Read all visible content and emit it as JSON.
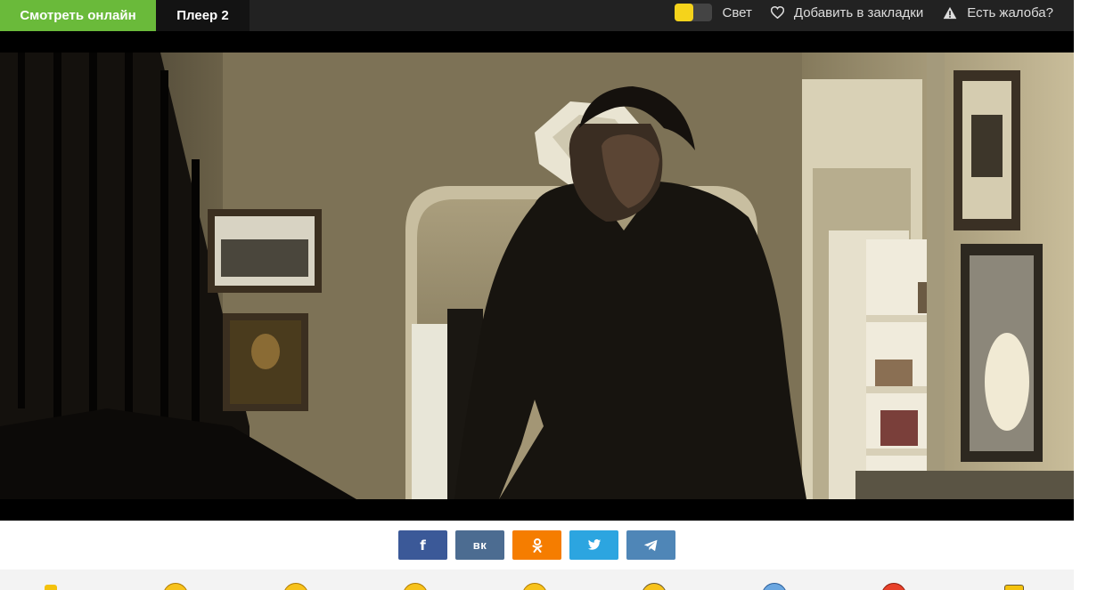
{
  "tabs": [
    {
      "label": "Смотреть онлайн",
      "active": true
    },
    {
      "label": "Плеер 2",
      "active": false
    }
  ],
  "toolbar": {
    "light_label": "Свет",
    "bookmark_label": "Добавить в закладки",
    "complaint_label": "Есть жалоба?"
  },
  "colors": {
    "accent_green": "#6aba3a",
    "toggle_yellow": "#f5d31b",
    "facebook": "#3b5998",
    "vk": "#4c6c91",
    "odnoklassniki": "#f57d00",
    "twitter": "#2ca5e0",
    "telegram": "#4f86b7"
  },
  "share": [
    {
      "network": "facebook",
      "icon": "facebook-icon",
      "glyph": "f"
    },
    {
      "network": "vk",
      "icon": "vk-icon",
      "glyph": "вк"
    },
    {
      "network": "odnoklassniki",
      "icon": "odnoklassniki-icon",
      "glyph": ""
    },
    {
      "network": "twitter",
      "icon": "twitter-icon",
      "glyph": ""
    },
    {
      "network": "telegram",
      "icon": "telegram-icon",
      "glyph": ""
    }
  ],
  "reactions": [
    {
      "icon": "thumbs-up-icon",
      "color": "#f4c20d"
    },
    {
      "icon": "smile-icon",
      "color": "#f7c21b"
    },
    {
      "icon": "laugh-icon",
      "color": "#f7c21b"
    },
    {
      "icon": "wink-icon",
      "color": "#f7c21b"
    },
    {
      "icon": "neutral-icon",
      "color": "#f7c21b"
    },
    {
      "icon": "surprised-icon",
      "color": "#f7c21b"
    },
    {
      "icon": "cold-icon",
      "color": "#6aa6e0"
    },
    {
      "icon": "angry-icon",
      "color": "#e8412a"
    },
    {
      "icon": "thumbs-down-icon",
      "color": "#f4c20d"
    }
  ]
}
